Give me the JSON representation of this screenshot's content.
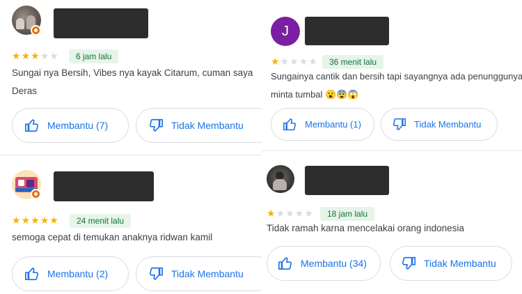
{
  "reviews_left": [
    {
      "rating": 3,
      "time": "6 jam lalu",
      "text_line1": "Sungai nya Bersih, Vibes nya kayak Citarum, cuman saya",
      "text_line2": "Deras",
      "helpful_label": "Membantu (7)",
      "not_helpful_label": "Tidak Membantu"
    },
    {
      "rating": 5,
      "time": "24 menit lalu",
      "text_line1": "semoga cepat di temukan anaknya ridwan kamil",
      "helpful_label": "Membantu (2)",
      "not_helpful_label": "Tidak Membantu"
    }
  ],
  "reviews_right": [
    {
      "avatar_initial": "J",
      "rating": 1,
      "time": "36 menit lalu",
      "text_line1": "Sungainya cantik dan bersih tapi sayangnya ada penunggunya la",
      "text_line2": "minta tumbal 😮😨😱",
      "helpful_label": "Membantu (1)",
      "not_helpful_label": "Tidak Membantu"
    },
    {
      "rating": 1,
      "time": "18 jam lalu",
      "text_line1": "Tidak ramah karna mencelakai orang indonesia",
      "helpful_label": "Membantu (34)",
      "not_helpful_label": "Tidak Membantu"
    }
  ],
  "colors": {
    "accent_blue": "#1a73e8",
    "star_gold": "#f4b400",
    "chip_bg": "#e6f4ea",
    "chip_text": "#137333",
    "avatar_purple": "#7b1fa2",
    "local_guide_orange": "#e8710a",
    "redaction": "#2d2d2d"
  },
  "icons": [
    "thumb-up-icon",
    "thumb-down-icon",
    "local-guide-badge-icon",
    "star-icon"
  ]
}
